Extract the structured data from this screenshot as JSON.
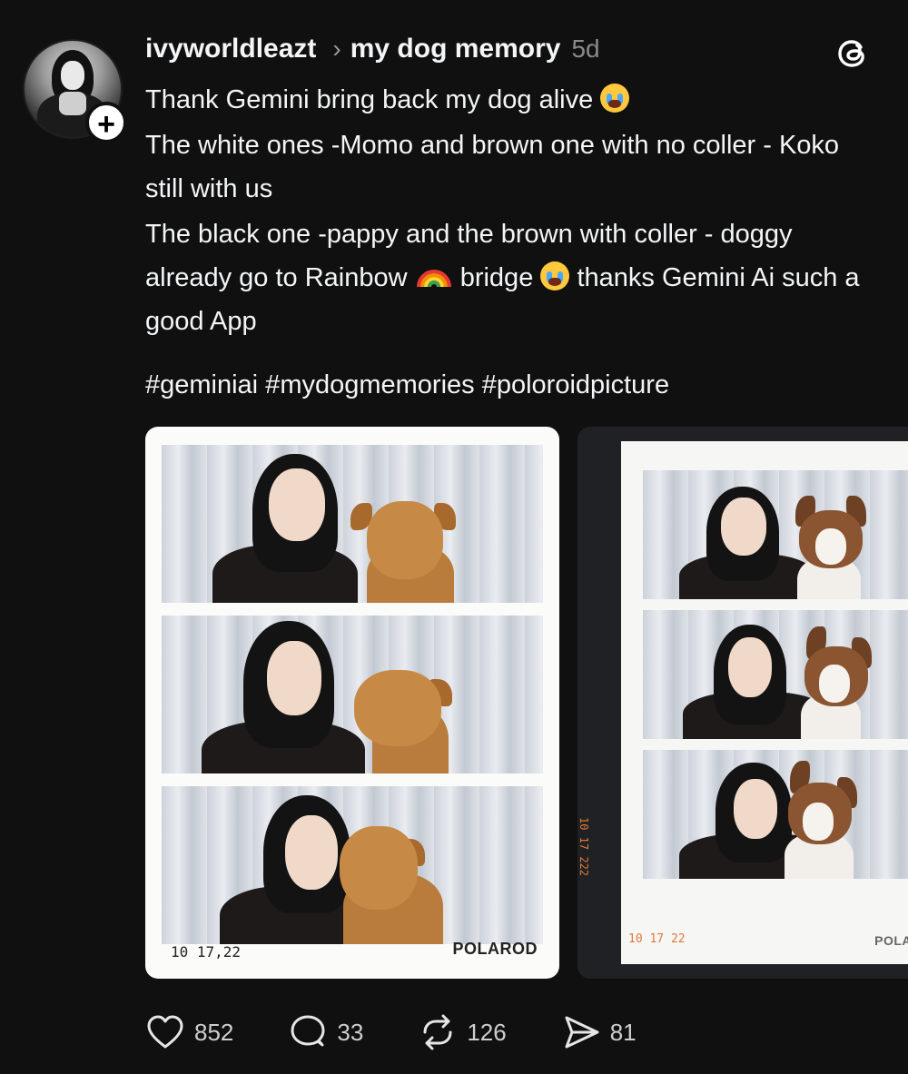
{
  "post": {
    "username": "ivyworldleazt",
    "topic": "my dog memory",
    "time": "5d",
    "follow_symbol": "+",
    "caption": {
      "line1": "Thank Gemini bring back my dog alive",
      "line2": "The white ones -Momo and brown one with no coller - Koko still with us",
      "line3a": "The black one -pappy and the brown with coller - doggy already go to Rainbow",
      "line3b": "bridge",
      "line3c": "thanks Gemini Ai such a good App",
      "hashtags": "#geminiai #mydogmemories #poloroidpicture"
    }
  },
  "media": [
    {
      "date_text": "10 17,22",
      "brand_text": "POLAROD"
    },
    {
      "side_date_text": "10 17 222",
      "date_text": "10 17 22",
      "brand_text": "POLARO"
    }
  ],
  "actions": {
    "likes": "852",
    "replies": "33",
    "reposts": "126",
    "shares": "81"
  },
  "colors": {
    "background": "#101010",
    "text": "#f3f5f7",
    "muted": "#8a8a8a",
    "accent_date": "#e07a3a"
  },
  "icons": [
    "threads-logo-icon",
    "chevron-right-icon",
    "plus-icon",
    "heart-icon",
    "comment-icon",
    "repost-icon",
    "share-icon"
  ]
}
